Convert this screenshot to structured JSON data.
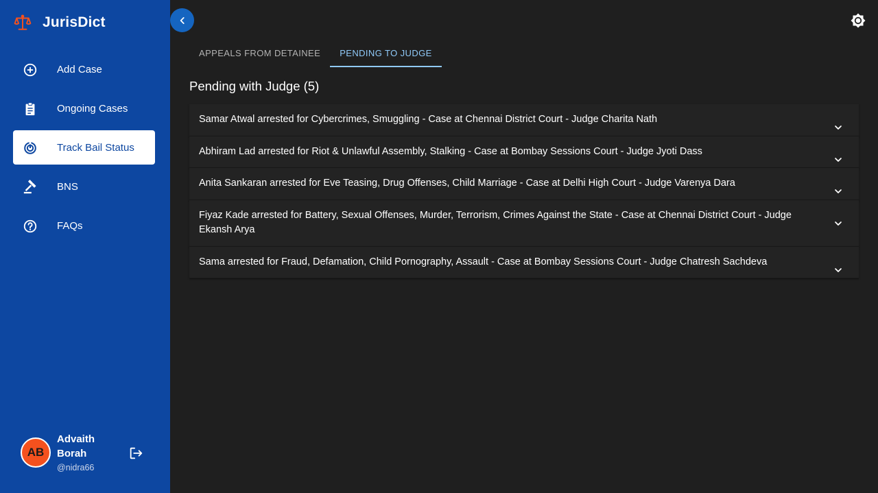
{
  "brand": {
    "name": "JurisDict",
    "icon": "scales-icon",
    "accent": "#f4511e"
  },
  "sidebar": {
    "bg": "#0d47a1",
    "items": [
      {
        "label": "Add Case",
        "icon": "add-circle-icon",
        "active": false
      },
      {
        "label": "Ongoing Cases",
        "icon": "clipboard-icon",
        "active": false
      },
      {
        "label": "Track Bail Status",
        "icon": "track-changes-icon",
        "active": true
      },
      {
        "label": "BNS",
        "icon": "gavel-icon",
        "active": false
      },
      {
        "label": "FAQs",
        "icon": "help-circle-icon",
        "active": false
      }
    ]
  },
  "user": {
    "initials": "AB",
    "name": "Advaith Borah",
    "handle": "@nidra66",
    "logout_icon": "logout-icon"
  },
  "header": {
    "collapse_icon": "chevron-left-icon",
    "theme_icon": "brightness-icon"
  },
  "tabs": [
    {
      "label": "APPEALS FROM DETAINEE",
      "active": false
    },
    {
      "label": "PENDING TO JUDGE",
      "active": true
    }
  ],
  "main": {
    "title": "Pending with Judge (5)",
    "cases": [
      "Samar Atwal arrested for Cybercrimes, Smuggling - Case at Chennai District Court - Judge Charita Nath",
      "Abhiram Lad arrested for Riot & Unlawful Assembly, Stalking - Case at Bombay Sessions Court - Judge Jyoti Dass",
      "Anita Sankaran arrested for Eve Teasing, Drug Offenses, Child Marriage - Case at Delhi High Court - Judge Varenya Dara",
      "Fiyaz Kade arrested for Battery, Sexual Offenses, Murder, Terrorism, Crimes Against the State - Case at Chennai District Court - Judge Ekansh Arya",
      "Sama arrested for Fraud, Defamation, Child Pornography, Assault - Case at Bombay Sessions Court - Judge Chatresh Sachdeva"
    ]
  }
}
